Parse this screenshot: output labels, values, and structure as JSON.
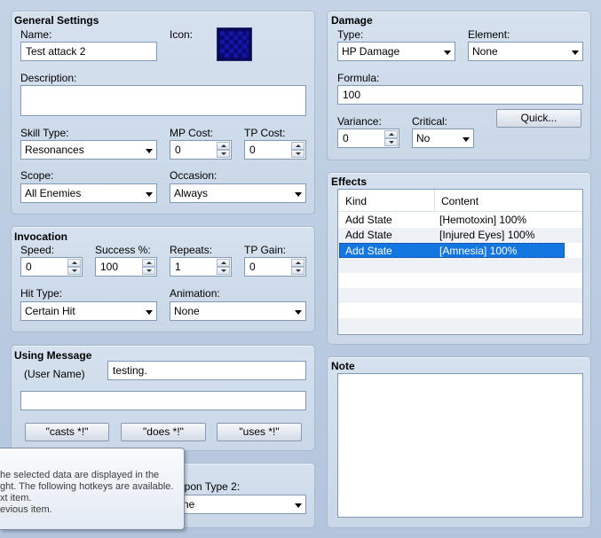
{
  "general": {
    "title": "General Settings",
    "name_label": "Name:",
    "name_value": "Test attack 2",
    "icon_label": "Icon:",
    "description_label": "Description:",
    "description_value": "",
    "skill_type_label": "Skill Type:",
    "skill_type_value": "Resonances",
    "mp_cost_label": "MP Cost:",
    "mp_cost_value": "0",
    "tp_cost_label": "TP Cost:",
    "tp_cost_value": "0",
    "scope_label": "Scope:",
    "scope_value": "All Enemies",
    "occasion_label": "Occasion:",
    "occasion_value": "Always"
  },
  "invocation": {
    "title": "Invocation",
    "speed_label": "Speed:",
    "speed_value": "0",
    "success_label": "Success %:",
    "success_value": "100",
    "repeats_label": "Repeats:",
    "repeats_value": "1",
    "tp_gain_label": "TP Gain:",
    "tp_gain_value": "0",
    "hit_type_label": "Hit Type:",
    "hit_type_value": "Certain Hit",
    "animation_label": "Animation:",
    "animation_value": "None"
  },
  "using_message": {
    "title": "Using Message",
    "user_name_label": "(User Name)",
    "line1_value": "testing.",
    "line2_value": "",
    "casts_button": "\"casts *!\"",
    "does_button": "\"does *!\"",
    "uses_button": "\"uses *!\""
  },
  "required_weapon": {
    "type2_label": "apon Type 2:",
    "type2_value": "ne"
  },
  "damage": {
    "title": "Damage",
    "type_label": "Type:",
    "type_value": "HP Damage",
    "element_label": "Element:",
    "element_value": "None",
    "formula_label": "Formula:",
    "formula_value": "100",
    "variance_label": "Variance:",
    "variance_value": "0",
    "critical_label": "Critical:",
    "critical_value": "No",
    "quick_button": "Quick..."
  },
  "effects": {
    "title": "Effects",
    "columns": [
      "Kind",
      "Content"
    ],
    "rows": [
      {
        "kind": "Add State",
        "content": "[Hemotoxin] 100%"
      },
      {
        "kind": "Add State",
        "content": "[Injured Eyes] 100%"
      },
      {
        "kind": "Add State",
        "content": "[Amnesia] 100%"
      }
    ]
  },
  "note": {
    "title": "Note",
    "value": ""
  },
  "tooltip": {
    "lines": [
      "he selected data are displayed in the",
      "ght. The following hotkeys are available.",
      "xt item.",
      "evious item."
    ]
  },
  "colors": {
    "selection": "#1476e1",
    "panel_bg": "#d6e1ee",
    "window_bg": "#c4d3e5"
  }
}
